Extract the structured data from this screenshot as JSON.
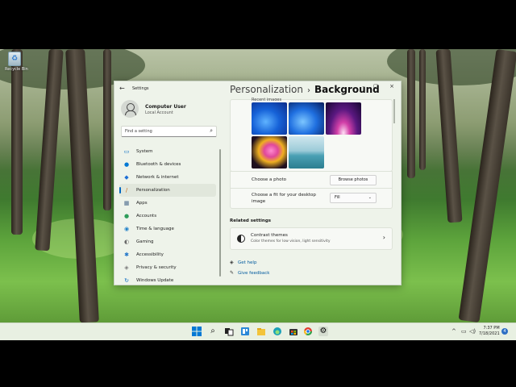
{
  "desktop": {
    "recycle_bin": "Recycle Bin"
  },
  "window": {
    "app_title": "Settings",
    "controls": {
      "minimize": "–",
      "maximize": "▢",
      "close": "×"
    },
    "back_icon": "arrow-left-icon"
  },
  "profile": {
    "name": "Computer User",
    "account": "Local Account"
  },
  "search": {
    "placeholder": "Find a setting"
  },
  "nav": [
    {
      "label": "System",
      "icon": "monitor-icon",
      "glyph": "▭",
      "color": "#0067c0",
      "selected": false
    },
    {
      "label": "Bluetooth & devices",
      "icon": "bluetooth-icon",
      "glyph": "●",
      "color": "#0078d4",
      "selected": false
    },
    {
      "label": "Network & internet",
      "icon": "wifi-icon",
      "glyph": "◆",
      "color": "#1d6fd6",
      "selected": false
    },
    {
      "label": "Personalization",
      "icon": "brush-icon",
      "glyph": "/",
      "color": "#c46a1a",
      "selected": true
    },
    {
      "label": "Apps",
      "icon": "apps-icon",
      "glyph": "▦",
      "color": "#4a6a8c",
      "selected": false
    },
    {
      "label": "Accounts",
      "icon": "person-icon",
      "glyph": "●",
      "color": "#2e9d5a",
      "selected": false
    },
    {
      "label": "Time & language",
      "icon": "globe-clock-icon",
      "glyph": "◉",
      "color": "#1f7fc8",
      "selected": false
    },
    {
      "label": "Gaming",
      "icon": "gamepad-icon",
      "glyph": "◐",
      "color": "#6a6a6a",
      "selected": false
    },
    {
      "label": "Accessibility",
      "icon": "accessibility-icon",
      "glyph": "✱",
      "color": "#1e73c8",
      "selected": false
    },
    {
      "label": "Privacy & security",
      "icon": "shield-icon",
      "glyph": "◈",
      "color": "#7a7a7a",
      "selected": false
    },
    {
      "label": "Windows Update",
      "icon": "update-icon",
      "glyph": "↻",
      "color": "#0a6bc2",
      "selected": false
    }
  ],
  "header": {
    "crumb": "Personalization",
    "separator": "›",
    "current": "Background"
  },
  "recent_images": {
    "label": "Recent images"
  },
  "choose_photo": {
    "label": "Choose a photo",
    "button": "Browse photos"
  },
  "fit": {
    "label_line1": "Choose a fit for your desktop",
    "label_line2": "image",
    "value": "Fill"
  },
  "related": {
    "heading": "Related settings",
    "contrast_title": "Contrast themes",
    "contrast_desc": "Color themes for low vision, light sensitivity"
  },
  "links": {
    "help": "Get help",
    "feedback": "Give feedback"
  },
  "taskbar": {
    "icons": [
      "windows-start-icon",
      "search-icon",
      "task-view-icon",
      "widgets-icon",
      "file-explorer-icon",
      "edge-icon",
      "store-icon",
      "chrome-icon",
      "settings-icon"
    ],
    "tray": {
      "chevron": "^",
      "network": "▭",
      "volume": "◁)"
    },
    "time": "7:37 PM",
    "date": "7/18/2021",
    "notification_count": "4"
  }
}
